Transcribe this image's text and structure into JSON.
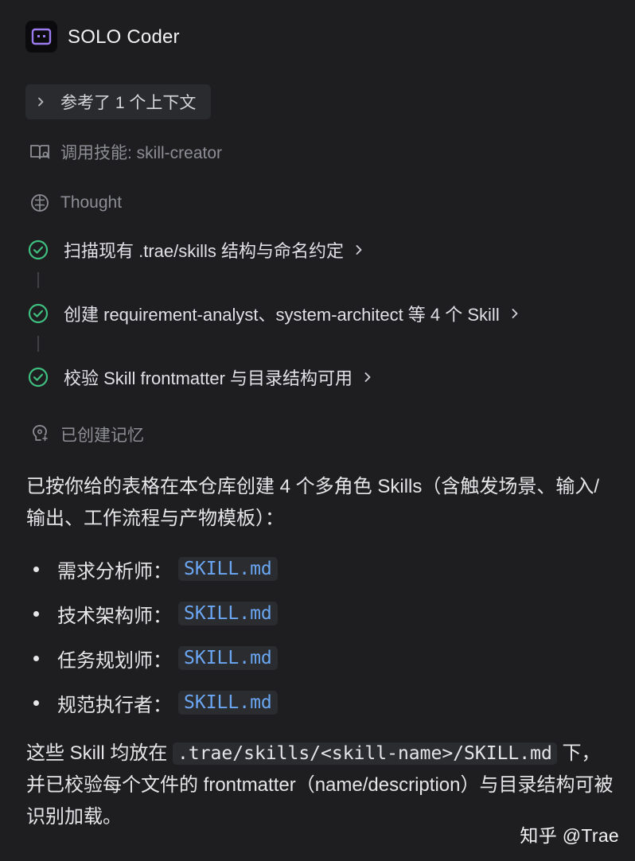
{
  "header": {
    "agent_name": "SOLO Coder",
    "avatar_icon": "robot-face-icon",
    "accent_color": "#9b7cf0"
  },
  "context": {
    "label": "参考了 1 个上下文"
  },
  "skill_call": {
    "label": "调用技能: skill-creator"
  },
  "thought": {
    "label": "Thought"
  },
  "steps": [
    {
      "label": "扫描现有 .trae/skills 结构与命名约定",
      "status": "done"
    },
    {
      "label": "创建 requirement-analyst、system-architect 等 4 个 Skill",
      "status": "done"
    },
    {
      "label": "校验 Skill frontmatter 与目录结构可用",
      "status": "done"
    }
  ],
  "memory": {
    "label": "已创建记忆"
  },
  "response": {
    "intro": "已按你给的表格在本仓库创建 4 个多角色 Skills（含触发场景、输入/输出、工作流程与产物模板）：",
    "items": [
      {
        "role": "需求分析师：",
        "file": "SKILL.md"
      },
      {
        "role": "技术架构师：",
        "file": "SKILL.md"
      },
      {
        "role": "任务规划师：",
        "file": "SKILL.md"
      },
      {
        "role": "规范执行者：",
        "file": "SKILL.md"
      }
    ],
    "closing_before": "这些 Skill 均放在 ",
    "closing_code": ".trae/skills/<skill-name>/SKILL.md",
    "closing_after": " 下，并已校验每个文件的 frontmatter（name/description）与目录结构可被识别加载。"
  },
  "watermark": "知乎 @Trae",
  "colors": {
    "background": "#1e1e21",
    "success_green": "#3fbf7f",
    "code_blue": "#6aa6f2"
  }
}
